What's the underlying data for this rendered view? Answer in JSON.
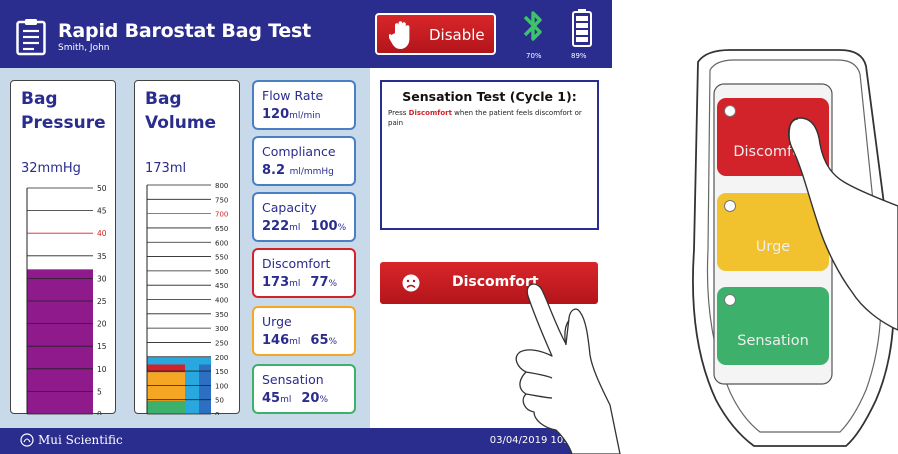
{
  "header": {
    "title": "Rapid Barostat Bag Test",
    "patient": "Smith, John",
    "disable_label": "Disable",
    "bluetooth_pct": "70%",
    "battery_pct": "89%"
  },
  "pressure": {
    "title_line1": "Bag",
    "title_line2": "Pressure",
    "value": "32mmHg",
    "fill_value": 32,
    "max": 50,
    "ticks": [
      "50",
      "45",
      "40",
      "35",
      "30",
      "25",
      "20",
      "15",
      "10",
      "5",
      "0"
    ],
    "red_tick": "40"
  },
  "volume": {
    "title_line1": "Bag",
    "title_line2": "Volume",
    "value": "173ml",
    "max": 800,
    "ticks": [
      "800",
      "750",
      "700",
      "650",
      "600",
      "550",
      "500",
      "450",
      "400",
      "350",
      "300",
      "250",
      "200",
      "150",
      "100",
      "50",
      "0"
    ],
    "red_tick": "700",
    "bands": {
      "sensation": 45,
      "urge": 146,
      "discomfort": 173,
      "current": 200
    }
  },
  "cards": {
    "flow": {
      "title": "Flow Rate",
      "value": "120",
      "unit": "ml/min"
    },
    "compliance": {
      "title": "Compliance",
      "value": "8.2",
      "unit": "ml/mmHg"
    },
    "capacity": {
      "title": "Capacity",
      "value": "222",
      "unit": "ml",
      "pct": "100",
      "pct_unit": "%"
    },
    "discomfort": {
      "title": "Discomfort",
      "value": "173",
      "unit": "ml",
      "pct": "77",
      "pct_unit": "%"
    },
    "urge": {
      "title": "Urge",
      "value": "146",
      "unit": "ml",
      "pct": "65",
      "pct_unit": "%"
    },
    "sensation": {
      "title": "Sensation",
      "value": "45",
      "unit": "ml",
      "pct": "20",
      "pct_unit": "%"
    }
  },
  "sensation_test": {
    "title": "Sensation Test (Cycle 1):",
    "text_before": "Press ",
    "text_highlight": "Discomfort",
    "text_after": " when the patient feels discomfort or pain"
  },
  "discomfort_button": {
    "label": "Discomfort"
  },
  "footer": {
    "company": "Mui Scientific",
    "datetime": "03/04/2019 10:32 AM"
  },
  "remote": {
    "discomfort": "Discomfort",
    "urge": "Urge",
    "sensation": "Sensation"
  },
  "colors": {
    "navy": "#2a2c8e",
    "panel_bg": "#c8d9ea",
    "pressure_fill": "#8e1a8c",
    "red": "#d2232a",
    "orange": "#f5a623",
    "yellow": "#f2c12e",
    "green": "#3db06b",
    "blue": "#2d6fc2",
    "cyan": "#29a8e0"
  }
}
